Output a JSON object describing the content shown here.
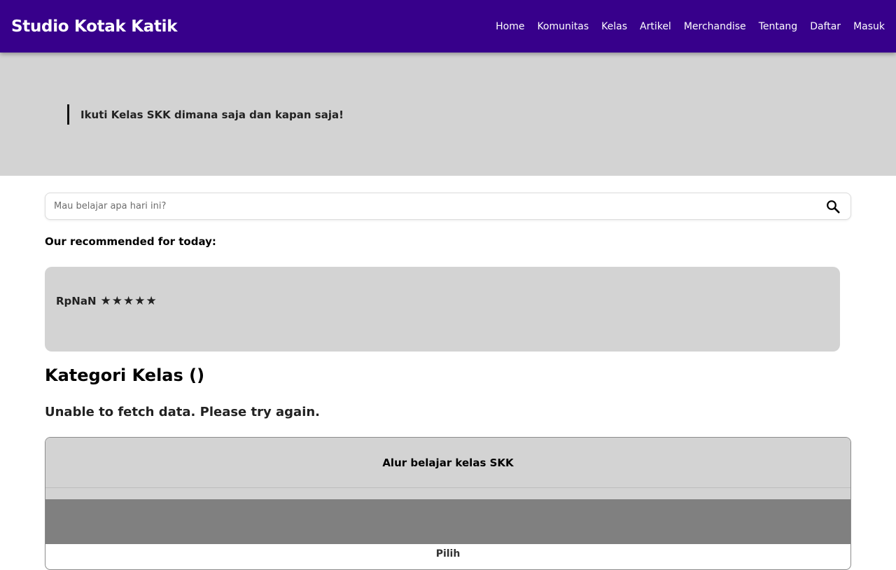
{
  "navbar": {
    "brand": "Studio Kotak Katik",
    "links": [
      "Home",
      "Komunitas",
      "Kelas",
      "Artikel",
      "Merchandise",
      "Tentang",
      "Daftar",
      "Masuk"
    ],
    "background": "#37008b"
  },
  "hero": {
    "quote": "Ikuti Kelas SKK dimana saja dan kapan saja!",
    "background": "#d3d3d3"
  },
  "search": {
    "placeholder": "Mau belajar apa hari ini?",
    "value": "",
    "icon": "search-icon"
  },
  "recommended": {
    "heading": "Our recommended for today:",
    "card": {
      "price": "RpNaN",
      "rating": 5,
      "stars": [
        "★",
        "★",
        "★",
        "★",
        "★"
      ]
    }
  },
  "category": {
    "title": "Kategori Kelas ()",
    "error": "Unable to fetch data. Please try again."
  },
  "flow": {
    "title": "Alur belajar kelas SKK",
    "choose_label": "Pilih"
  }
}
